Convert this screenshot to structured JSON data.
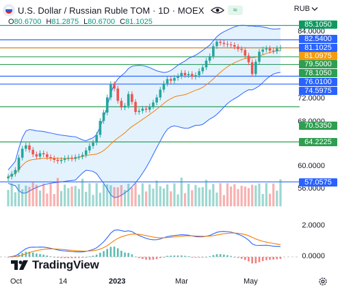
{
  "header": {
    "title": "U.S. Dollar / Russian Ruble TOM · 1D · MOEX",
    "wave_label": "≈",
    "ohlc": [
      {
        "key": "O",
        "value": "80.6700"
      },
      {
        "key": "H",
        "value": "81.2875"
      },
      {
        "key": "L",
        "value": "80.6700"
      },
      {
        "key": "C",
        "value": "81.1025"
      }
    ],
    "currency": "RUB"
  },
  "price_axis": {
    "labels": [
      "84.0000",
      "72.0000",
      "68.0000",
      "60.0000",
      "56.0000"
    ]
  },
  "level_tags": [
    {
      "label": "85.1050",
      "color": "#0f9960"
    },
    {
      "label": "82.5400",
      "color": "#2962ff"
    },
    {
      "label": "81.1025",
      "color": "#2962ff"
    },
    {
      "label": "81.0975",
      "color": "#f39c12"
    },
    {
      "label": "79.5000",
      "color": "#2e9e50"
    },
    {
      "label": "78.1050",
      "color": "#2e9e50"
    },
    {
      "label": "76.0100",
      "color": "#2962ff"
    },
    {
      "label": "74.5975",
      "color": "#2962ff"
    },
    {
      "label": "70.5350",
      "color": "#2e9e50"
    },
    {
      "label": "64.2225",
      "color": "#2e9e50"
    },
    {
      "label": "57.0575",
      "color": "#2962ff"
    }
  ],
  "macd_axis": {
    "labels": [
      "2.0000",
      "0.0000"
    ]
  },
  "time_axis": {
    "labels": [
      "Oct",
      "14",
      "2023",
      "Mar",
      "May"
    ]
  },
  "brand": {
    "name": "TradingView"
  },
  "chart_data": {
    "type": "candlestick",
    "title": "U.S. Dollar / Russian Ruble TOM · 1D · MOEX",
    "x_ticks": [
      "Oct",
      "14",
      "2023",
      "Mar",
      "May"
    ],
    "y_range": [
      55,
      86
    ],
    "close_series": [
      58.0,
      58.5,
      59.2,
      61.4,
      63.0,
      63.6,
      62.8,
      62.0,
      61.6,
      62.2,
      62.0,
      61.5,
      61.3,
      61.0,
      60.8,
      61.0,
      61.3,
      61.4,
      61.2,
      61.5,
      61.6,
      61.9,
      62.7,
      63.5,
      64.1,
      65.5,
      68.0,
      69.5,
      72.2,
      74.6,
      73.8,
      71.6,
      70.4,
      70.7,
      72.8,
      71.4,
      69.6,
      69.8,
      70.2,
      70.0,
      70.6,
      71.3,
      72.2,
      73.6,
      74.7,
      75.5,
      75.2,
      75.7,
      76.0,
      76.6,
      76.2,
      76.4,
      75.9,
      76.2,
      76.9,
      77.6,
      78.8,
      79.6,
      81.4,
      82.2,
      82.0,
      81.8,
      81.7,
      81.6,
      81.3,
      80.9,
      80.7,
      79.7,
      78.5,
      76.4,
      78.6,
      80.4,
      80.8,
      81.0,
      80.6,
      80.5,
      81.0,
      81.1025
    ],
    "levels": [
      85.105,
      82.54,
      81.1025,
      81.0975,
      79.5,
      78.105,
      76.01,
      74.5975,
      70.535,
      64.2225,
      57.0575
    ],
    "indicators": [
      "Bollinger Bands",
      "Volume",
      "MACD"
    ],
    "macd_range": [
      -1,
      3
    ]
  }
}
